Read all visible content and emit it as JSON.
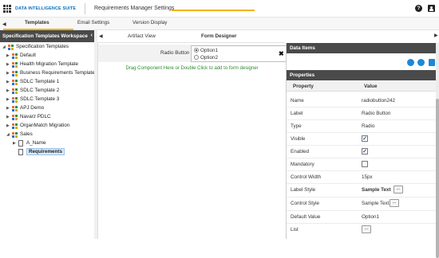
{
  "app": {
    "brand": "DATA INTELLIGENCE SUITE",
    "title": "Requirements Manager Settings",
    "help_glyph": "?"
  },
  "top_tabs": [
    {
      "label": "Templates",
      "active": true
    },
    {
      "label": "Email Settings",
      "active": false
    },
    {
      "label": "Version Display",
      "active": false
    }
  ],
  "left_panel": {
    "header": "Specification Templates Workspace",
    "tree": [
      {
        "label": "Specification Templates",
        "level": 0,
        "type": "root",
        "expanded": true
      },
      {
        "label": "Default",
        "level": 1,
        "type": "template"
      },
      {
        "label": "Health Migration Template",
        "level": 1,
        "type": "template"
      },
      {
        "label": "Business Requirements Template",
        "level": 1,
        "type": "template"
      },
      {
        "label": "SDLC Template 1",
        "level": 1,
        "type": "template"
      },
      {
        "label": "SDLC Template 2",
        "level": 1,
        "type": "template"
      },
      {
        "label": "SDLC Template 3",
        "level": 1,
        "type": "template"
      },
      {
        "label": "APJ Demo",
        "level": 1,
        "type": "template"
      },
      {
        "label": "Navarz PDLC",
        "level": 1,
        "type": "template"
      },
      {
        "label": "OrganMatch Migration",
        "level": 1,
        "type": "template"
      },
      {
        "label": "Sales",
        "level": 1,
        "type": "template",
        "expanded": true
      },
      {
        "label": "A_Name",
        "level": 2,
        "type": "doc"
      },
      {
        "label": "Requirements",
        "level": 2,
        "type": "doc",
        "selected": true
      }
    ]
  },
  "center": {
    "tabs": [
      {
        "label": "Artifact View",
        "active": false
      },
      {
        "label": "Form Designer",
        "active": true
      }
    ],
    "field_label": "Radio Button",
    "radio_options": [
      {
        "label": "Option1",
        "checked": true
      },
      {
        "label": "Option2",
        "checked": false
      }
    ],
    "close_glyph": "✖",
    "drop_hint": "Drag Component Here or Double Click to add to form designer"
  },
  "right_panel": {
    "data_items_header": "Data Items",
    "properties_header": "Properties",
    "columns": [
      "Property",
      "Value"
    ],
    "rows": [
      {
        "name": "Name",
        "value": "radiobutton242",
        "kind": "text"
      },
      {
        "name": "Label",
        "value": "Radio Button",
        "kind": "text"
      },
      {
        "name": "Type",
        "value": "Radio",
        "kind": "text"
      },
      {
        "name": "Visible",
        "value": "checked",
        "kind": "checkbox"
      },
      {
        "name": "Enabled",
        "value": "checked",
        "kind": "checkbox"
      },
      {
        "name": "Mandatory",
        "value": "unchecked",
        "kind": "checkbox"
      },
      {
        "name": "Control Width",
        "value": "15px",
        "kind": "text"
      },
      {
        "name": "Label Style",
        "value": "Sample Text",
        "kind": "style"
      },
      {
        "name": "Control Style",
        "value": "Sample Text",
        "kind": "style"
      },
      {
        "name": "Default Value",
        "value": "Option1",
        "kind": "text"
      },
      {
        "name": "List",
        "value": "",
        "kind": "button"
      }
    ],
    "ellipsis_label": "..."
  },
  "colors": {
    "accent": "#f0b300",
    "header_bg": "#4a4a4a",
    "brand": "#0a6fb5",
    "hint": "#2e8b2e",
    "icon_blue": "#1e88d8"
  }
}
